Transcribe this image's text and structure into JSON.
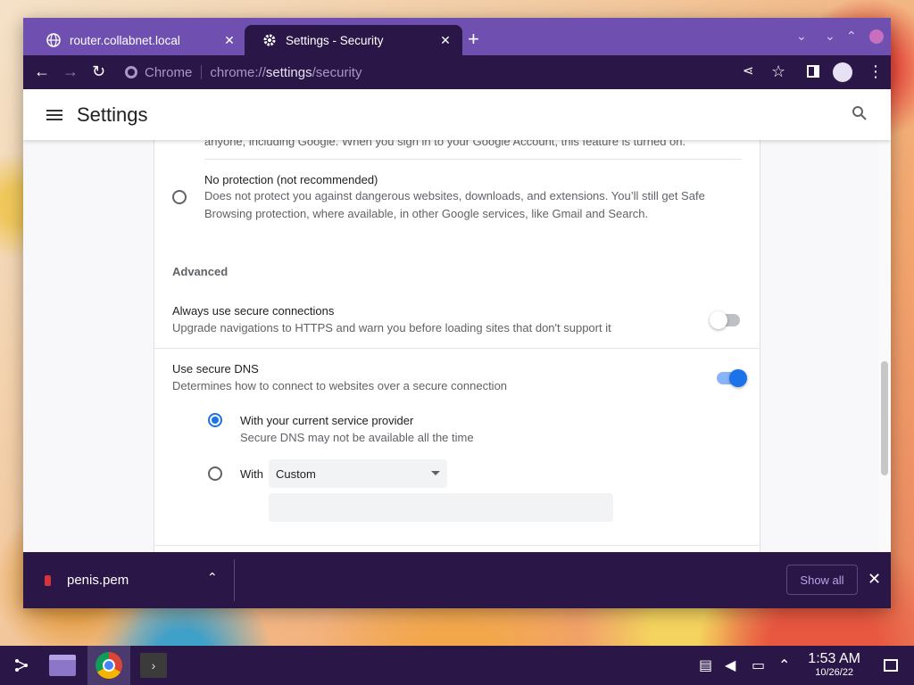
{
  "browser": {
    "tabs": [
      {
        "title": "router.collabnet.local",
        "active": false
      },
      {
        "title": "Settings - Security",
        "active": true
      }
    ],
    "omnibox": {
      "scheme_label": "Chrome",
      "url_prefix": "chrome://",
      "url_host": "settings",
      "url_path": "/security"
    }
  },
  "settings": {
    "title": "Settings",
    "cut_text": "anyone, including Google. When you sign in to your Google Account, this feature is turned on.",
    "no_protection": {
      "label": "No protection (not recommended)",
      "desc_line1": "Does not protect you against dangerous websites, downloads, and extensions. You’ll still get Safe",
      "desc_line2": "Browsing protection, where available, in other Google services, like Gmail and Search."
    },
    "advanced_title": "Advanced",
    "secure_connections": {
      "label": "Always use secure connections",
      "desc": "Upgrade navigations to HTTPS and warn you before loading sites that don't support it",
      "enabled": false
    },
    "secure_dns": {
      "label": "Use secure DNS",
      "desc": "Determines how to connect to websites over a secure connection",
      "enabled": true,
      "option_current": {
        "label": "With your current service provider",
        "desc": "Secure DNS may not be available all the time"
      },
      "option_custom": {
        "label": "With",
        "select_value": "Custom"
      }
    }
  },
  "downloads": {
    "file_name": "penis.pem",
    "show_all": "Show all"
  },
  "taskbar": {
    "time": "1:53 AM",
    "date": "10/26/22"
  }
}
